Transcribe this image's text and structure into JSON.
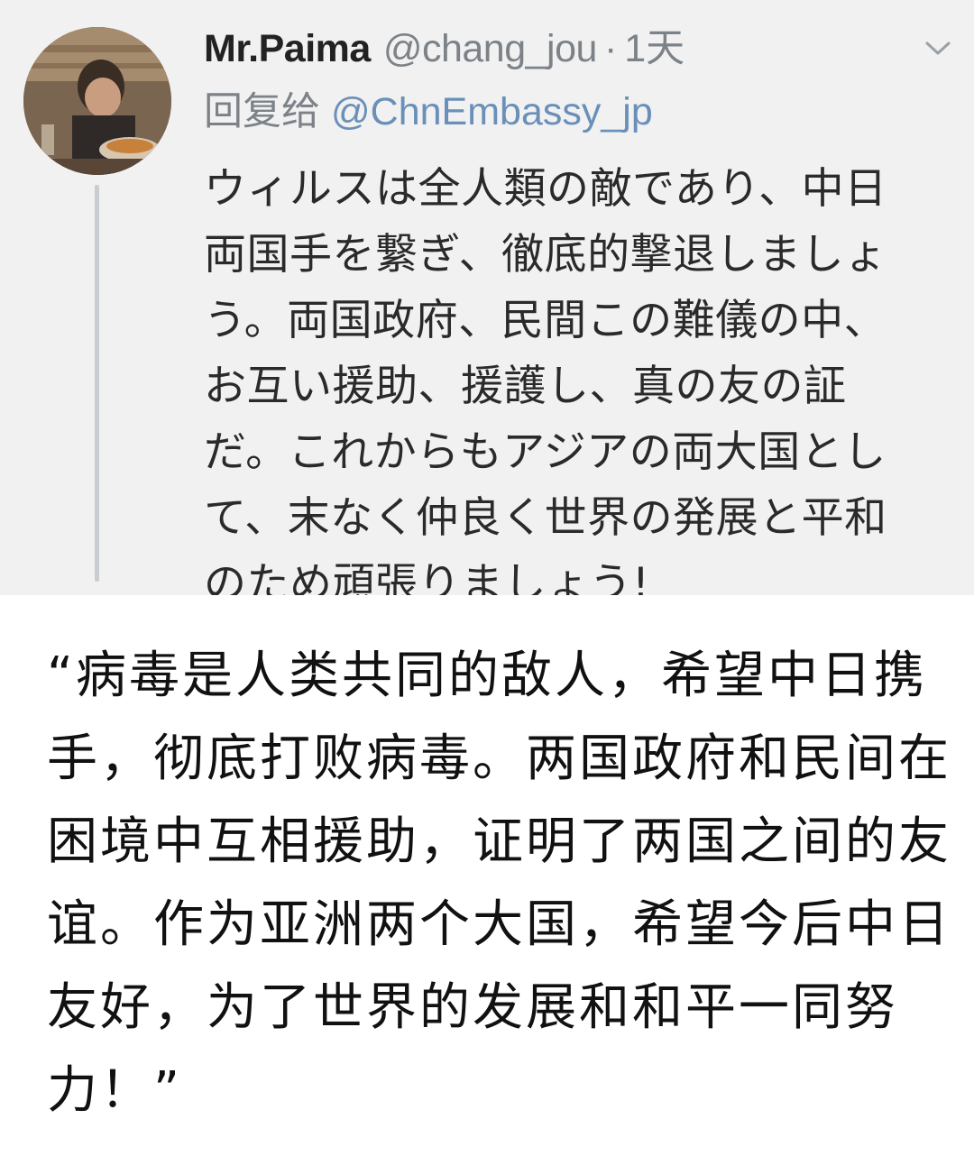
{
  "tweet": {
    "display_name": "Mr.Paima",
    "handle": "@chang_jou",
    "separator": "·",
    "time": "1天",
    "reply_prefix": "回复给",
    "reply_target": "@ChnEmbassy_jp",
    "body_lines": [
      "ウィルスは全人類の敵であり、中日",
      "両国手を繋ぎ、徹底的撃退しましょ",
      "う。両国政府、民間この難儀の中、",
      "お互い援助、援護し、真の友の証",
      "だ。これからもアジアの両大国とし",
      "て、末なく仲良く世界の発展と平和",
      "のため頑張りましょう!"
    ]
  },
  "caption": {
    "lines": [
      "“病毒是人类共同的敌人，希望中日携",
      "手，彻底打败病毒。两国政府和民间在",
      "困境中互相援助，证明了两国之间的友",
      "谊。作为亚洲两个大国，希望今后中日",
      "友好，为了世界的发展和和平一同努",
      "力！”"
    ]
  },
  "colors": {
    "panel_bg": "#f1f1f1",
    "muted": "#7c8288",
    "link": "#6a8fb8",
    "page_bg": "#ffffff"
  },
  "icons": {
    "menu": "chevron-down-icon",
    "avatar": "avatar"
  }
}
